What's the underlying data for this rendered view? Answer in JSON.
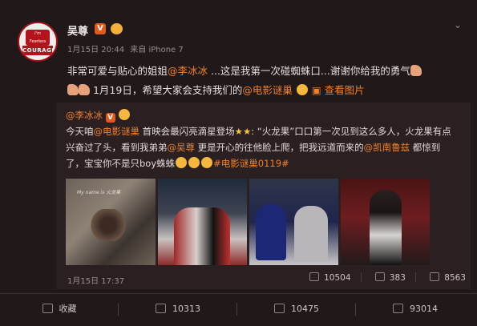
{
  "post": {
    "username": "吴尊",
    "verified_badge": "V",
    "time": "1月15日 20:44",
    "source": "来自 iPhone 7",
    "text_line1_a": "非常可爱与贴心的姐姐",
    "mention1": "@李冰冰",
    "text_line1_b": " ...这是我第一次碰蜘蛛口...谢谢你给我的勇气",
    "text_line2_a": " 1月19日，希望大家会支持我们的",
    "mention2": "@电影谜巢",
    "view_image_label": "查看图片",
    "avatar_top": "I'm Fearless",
    "avatar_banner": "COURAGE"
  },
  "repost": {
    "author": "@李冰冰",
    "verified_badge": "V",
    "line1_a": "今天咱",
    "line1_link": "@电影谜巢",
    "line1_b": " 首映会最闪亮滴星登场",
    "line1_c": ": “火龙果”口口第一次见到这么多人，火龙果有点",
    "line2_a": "兴奋过了头，看到我弟弟",
    "line2_link": "@吴尊",
    "line2_b": " 更是开心的往他脸上爬，把我远道而来的",
    "line2_link2": "@凯南鲁兹",
    "line2_c": " 都惊到",
    "line3_a": "了，宝宝你不是只boy蛛蛛",
    "hashtag": "#电影谜巢0119#",
    "photo1_caption": "My name is 火龙果",
    "time": "1月15日 17:37",
    "reposts": "10504",
    "comments": "383",
    "likes": "8563"
  },
  "actions": {
    "favorite": "收藏",
    "repost": "10313",
    "comment": "10475",
    "like": "93014"
  }
}
